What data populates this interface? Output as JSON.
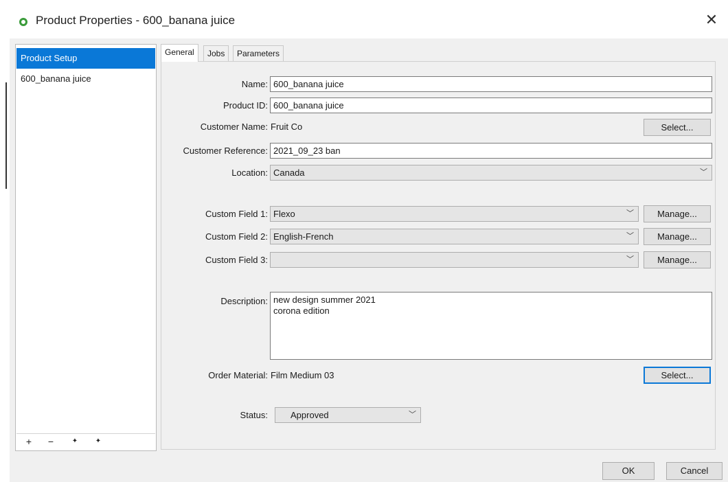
{
  "window": {
    "title": "Product Properties - 600_banana juice",
    "close_glyph": "✕",
    "app_icon": "circle-app-icon",
    "accent_color": "#0a78d7"
  },
  "sidebar": {
    "header": "Product Setup",
    "items": [
      {
        "label": "600_banana juice"
      }
    ],
    "toolbar": {
      "add": "+",
      "remove": "−",
      "move_up": "✦",
      "move_down": "✦"
    }
  },
  "tabs": [
    {
      "label": "General",
      "active": true
    },
    {
      "label": "Jobs",
      "active": false
    },
    {
      "label": "Parameters",
      "active": false
    }
  ],
  "form": {
    "name": {
      "label": "Name:",
      "value": "600_banana juice"
    },
    "product_id": {
      "label": "Product ID:",
      "value": "600_banana juice"
    },
    "customer_name": {
      "label": "Customer Name:",
      "value": "Fruit Co",
      "button": "Select..."
    },
    "customer_reference": {
      "label": "Customer Reference:",
      "value": "2021_09_23 ban"
    },
    "location": {
      "label": "Location:",
      "value": "Canada"
    },
    "custom_field_1": {
      "label": "Custom Field 1:",
      "value": "Flexo",
      "button": "Manage..."
    },
    "custom_field_2": {
      "label": "Custom Field 2:",
      "value": "English-French",
      "button": "Manage..."
    },
    "custom_field_3": {
      "label": "Custom Field 3:",
      "value": "",
      "button": "Manage..."
    },
    "description": {
      "label": "Description:",
      "lines": [
        "new design summer 2021",
        "corona edition"
      ]
    },
    "order_material": {
      "label": "Order Material:",
      "value": "Film Medium 03",
      "button": "Select..."
    },
    "status": {
      "label": "Status:",
      "value": "Approved"
    }
  },
  "footer": {
    "ok": "OK",
    "cancel": "Cancel"
  },
  "chevron_glyph": "﹀"
}
